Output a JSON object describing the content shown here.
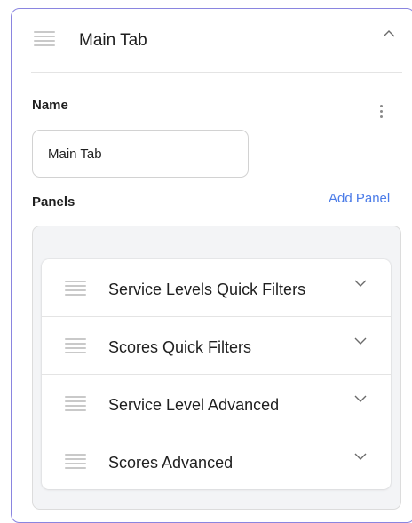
{
  "tab": {
    "title": "Main Tab",
    "collapse_icon": "chevron-up-icon",
    "menu_icon": "kebab-menu-icon"
  },
  "name_field": {
    "label": "Name",
    "value": "Main Tab"
  },
  "panels": {
    "label": "Panels",
    "add_label": "Add Panel",
    "items": [
      {
        "label": "Service Levels Quick Filters",
        "icon": "chevron-down-icon"
      },
      {
        "label": "Scores Quick Filters",
        "icon": "chevron-down-icon"
      },
      {
        "label": "Service Level Advanced",
        "icon": "chevron-down-icon"
      },
      {
        "label": "Scores Advanced",
        "icon": "chevron-down-icon"
      }
    ]
  },
  "colors": {
    "card_border": "#8a85e0",
    "link": "#4a7be8",
    "panel_box_bg": "#f3f4f6"
  }
}
